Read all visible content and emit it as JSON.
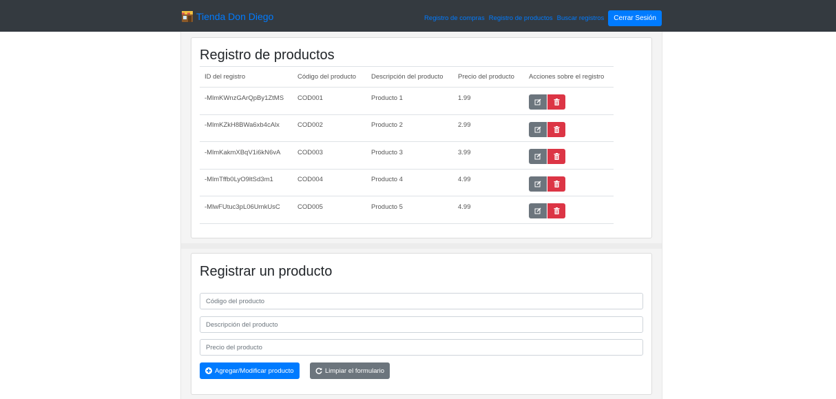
{
  "navbar": {
    "brand": "Tienda Don Diego",
    "links": [
      "Registro de compras",
      "Registro de productos",
      "Buscar registros"
    ],
    "logout_label": "Cerrar Sesión"
  },
  "products_card": {
    "title": "Registro de productos",
    "columns": [
      "ID del registro",
      "Código del producto",
      "Descripción del producto",
      "Precio del producto",
      "Acciones sobre el registro"
    ],
    "rows": [
      {
        "id": "-MlmKWnzGArQpBy1ZtMS",
        "code": "COD001",
        "description": "Producto 1",
        "price": "1.99"
      },
      {
        "id": "-MlmKZkH8BWa6xb4cAlx",
        "code": "COD002",
        "description": "Producto 2",
        "price": "2.99"
      },
      {
        "id": "-MlmKakmXBqV1i6kN6vA",
        "code": "COD003",
        "description": "Producto 3",
        "price": "3.99"
      },
      {
        "id": "-MlmTffb0LyO9ltSd3m1",
        "code": "COD004",
        "description": "Producto 4",
        "price": "4.99"
      },
      {
        "id": "-MlwFUtuc3pL06UmkUsC",
        "code": "COD005",
        "description": "Producto 5",
        "price": "4.99"
      }
    ]
  },
  "form_card": {
    "title": "Registrar un producto",
    "code_placeholder": "Código del producto",
    "description_placeholder": "Descripción del producto",
    "price_placeholder": "Precio del producto",
    "add_label": "Agregar/Modificar producto",
    "clear_label": "Limpiar el formulario"
  },
  "icons": {
    "brand": "store-icon",
    "edit": "edit-icon",
    "delete": "trash-icon",
    "add": "plus-circle-icon",
    "clear": "refresh-icon"
  },
  "colors": {
    "navbar_bg": "#343a40",
    "primary": "#007bff",
    "secondary": "#6c757d",
    "danger": "#dc3545"
  }
}
